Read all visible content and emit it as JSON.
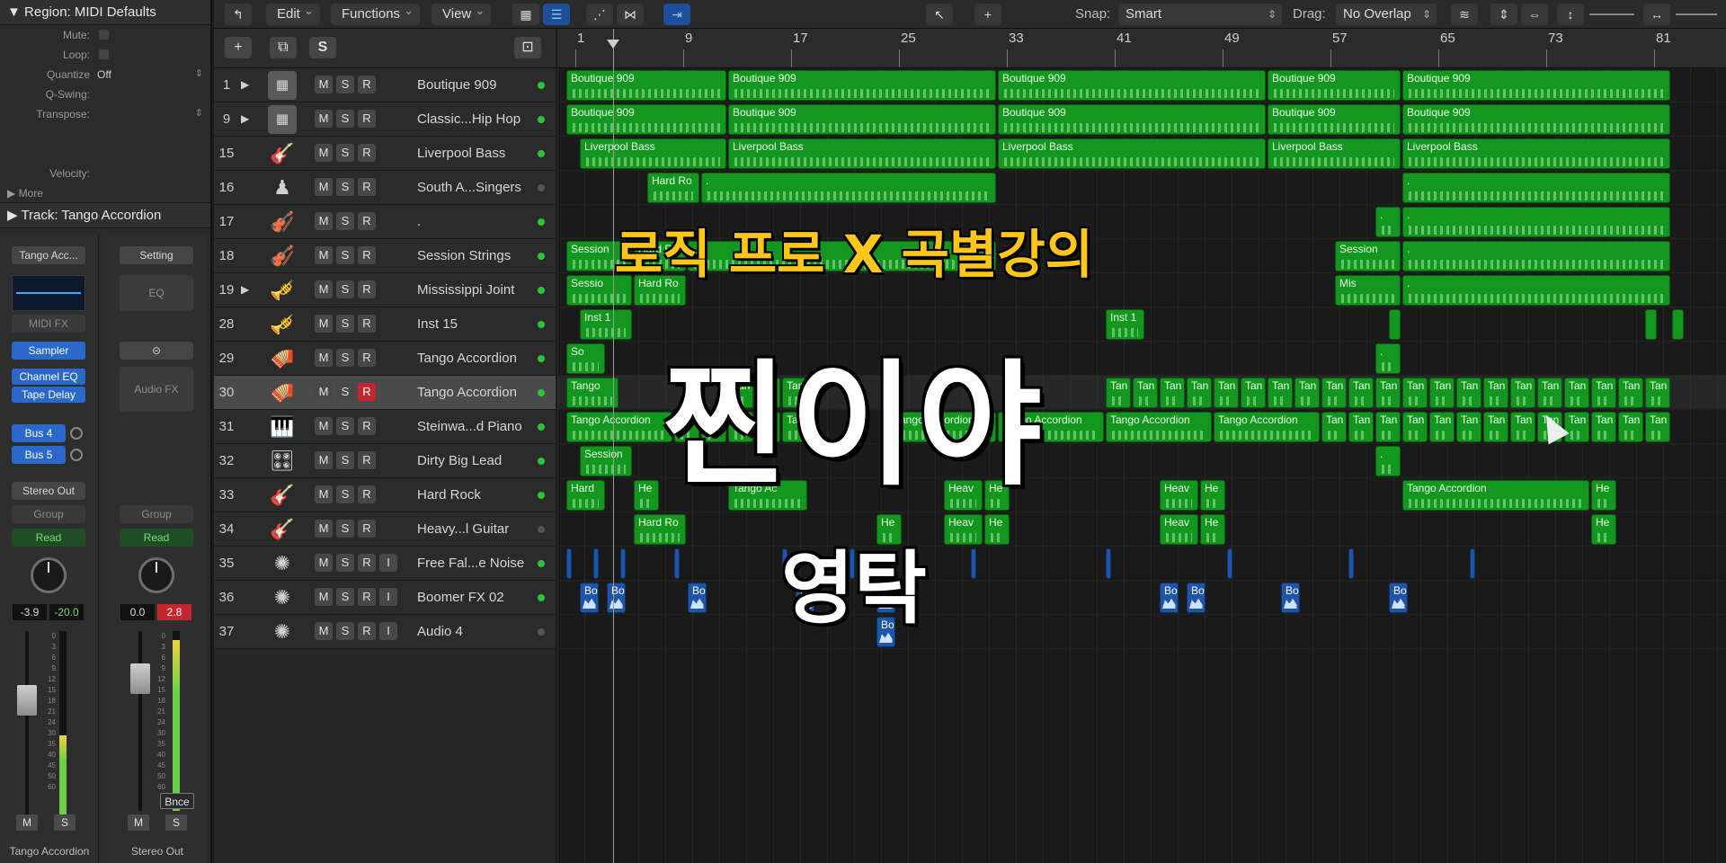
{
  "inspector": {
    "region_title": "Region: MIDI Defaults",
    "fields": [
      {
        "label": "Mute:",
        "value": "",
        "checkbox": true
      },
      {
        "label": "Loop:",
        "value": "",
        "checkbox": true
      },
      {
        "label": "Quantize",
        "value": "Off",
        "updown": true
      },
      {
        "label": "Q-Swing:",
        "value": ""
      },
      {
        "label": "Transpose:",
        "value": "",
        "updown": true
      },
      {
        "label": "",
        "value": ""
      },
      {
        "label": "",
        "value": ""
      },
      {
        "label": "Velocity:",
        "value": ""
      }
    ],
    "more": "More",
    "track_title": "Track:  Tango Accordion",
    "strip1": {
      "setting": "Tango Acc...",
      "midi_fx": "MIDI FX",
      "instrument": "Sampler",
      "fx1": "Channel EQ",
      "fx2": "Tape Delay",
      "send1": "Bus 4",
      "send2": "Bus 5",
      "output": "Stereo Out",
      "group": "Group",
      "automation": "Read",
      "level_left": "-3.9",
      "level_right": "-20.0",
      "mute": "M",
      "solo": "S",
      "name": "Tango Accordion"
    },
    "strip2": {
      "setting": "Setting",
      "eq": "EQ",
      "link": "⊝",
      "audio_fx": "Audio FX",
      "group": "Group",
      "automation": "Read",
      "level_left": "0.0",
      "level_right": "2.8",
      "bounce": "Bnce",
      "mute": "M",
      "solo": "S",
      "name": "Stereo Out"
    },
    "scale": [
      "0",
      "3",
      "6",
      "9",
      "12",
      "15",
      "18",
      "21",
      "24",
      "30",
      "35",
      "40",
      "45",
      "50",
      "60"
    ]
  },
  "toolbar": {
    "back_icon": "↰",
    "menus": [
      "Edit",
      "Functions",
      "View"
    ],
    "snap_label": "Snap:",
    "snap_value": "Smart",
    "drag_label": "Drag:",
    "drag_value": "No Overlap"
  },
  "ruler": [
    "1",
    "9",
    "17",
    "25",
    "33",
    "41",
    "49",
    "57",
    "65",
    "73",
    "81"
  ],
  "tracks": [
    {
      "num": "1",
      "name": "Boutique 909",
      "icon": "drum-machine-icon",
      "glyph": "▦",
      "disc": true,
      "input": false,
      "led": "#2ec43a"
    },
    {
      "num": "9",
      "name": "Classic...Hip Hop",
      "icon": "drum-machine-icon",
      "glyph": "▦",
      "disc": true,
      "input": false,
      "led": "#2ec43a"
    },
    {
      "num": "15",
      "name": "Liverpool Bass",
      "icon": "bass-guitar-icon",
      "glyph": "🎸",
      "disc": false,
      "input": false,
      "led": "#2ec43a"
    },
    {
      "num": "16",
      "name": "South A...Singers",
      "icon": "choir-icon",
      "glyph": "♟",
      "disc": false,
      "input": false,
      "led": "#555555"
    },
    {
      "num": "17",
      "name": ".",
      "icon": "violin-icon",
      "glyph": "🎻",
      "disc": false,
      "input": false,
      "led": "#2ec43a"
    },
    {
      "num": "18",
      "name": "Session Strings",
      "icon": "strings-icon",
      "glyph": "🎻",
      "disc": false,
      "input": false,
      "led": "#2ec43a"
    },
    {
      "num": "19",
      "name": "Mississippi Joint",
      "icon": "horns-icon",
      "glyph": "🎺",
      "disc": true,
      "input": false,
      "led": "#2ec43a"
    },
    {
      "num": "28",
      "name": "Inst 15",
      "icon": "horns-icon",
      "glyph": "🎺",
      "disc": false,
      "input": false,
      "led": "#2ec43a"
    },
    {
      "num": "29",
      "name": "Tango Accordion",
      "icon": "accordion-icon",
      "glyph": "🪗",
      "disc": false,
      "input": false,
      "led": "#2ec43a"
    },
    {
      "num": "30",
      "name": "Tango Accordion",
      "icon": "accordion-icon",
      "glyph": "🪗",
      "disc": false,
      "input": false,
      "led": "#2ec43a",
      "selected": true,
      "armed": true
    },
    {
      "num": "31",
      "name": "Steinwa...d Piano",
      "icon": "grand-piano-icon",
      "glyph": "🎹",
      "disc": false,
      "input": false,
      "led": "#2ec43a"
    },
    {
      "num": "32",
      "name": "Dirty Big Lead",
      "icon": "synth-icon",
      "glyph": "🎛",
      "disc": false,
      "input": false,
      "led": "#2ec43a"
    },
    {
      "num": "33",
      "name": "Hard Rock",
      "icon": "electric-guitar-icon",
      "glyph": "🎸",
      "disc": false,
      "input": false,
      "led": "#2ec43a"
    },
    {
      "num": "34",
      "name": "Heavy...l Guitar",
      "icon": "electric-guitar-icon",
      "glyph": "🎸",
      "disc": false,
      "input": false,
      "led": "#555555"
    },
    {
      "num": "35",
      "name": "Free Fal...e Noise",
      "icon": "fx-burst-icon",
      "glyph": "✺",
      "disc": false,
      "input": true,
      "led": "#2ec43a"
    },
    {
      "num": "36",
      "name": "Boomer FX 02",
      "icon": "fx-burst-icon",
      "glyph": "✺",
      "disc": false,
      "input": true,
      "led": "#2ec43a"
    },
    {
      "num": "37",
      "name": "Audio 4",
      "icon": "fx-burst-icon",
      "glyph": "✺",
      "disc": false,
      "input": true,
      "led": "#555555"
    }
  ],
  "regions": [
    {
      "lane": 0,
      "bar": 1,
      "len": 12,
      "name": "Boutique 909"
    },
    {
      "lane": 0,
      "bar": 13,
      "len": 20,
      "name": "Boutique 909"
    },
    {
      "lane": 0,
      "bar": 33,
      "len": 20,
      "name": "Boutique 909"
    },
    {
      "lane": 0,
      "bar": 53,
      "len": 10,
      "name": "Boutique 909"
    },
    {
      "lane": 0,
      "bar": 63,
      "len": 20,
      "name": "Boutique 909"
    },
    {
      "lane": 1,
      "bar": 1,
      "len": 12,
      "name": "Boutique 909"
    },
    {
      "lane": 1,
      "bar": 13,
      "len": 20,
      "name": "Boutique 909"
    },
    {
      "lane": 1,
      "bar": 33,
      "len": 20,
      "name": "Boutique 909"
    },
    {
      "lane": 1,
      "bar": 53,
      "len": 10,
      "name": "Boutique 909"
    },
    {
      "lane": 1,
      "bar": 63,
      "len": 20,
      "name": "Boutique 909"
    },
    {
      "lane": 2,
      "bar": 2,
      "len": 11,
      "name": "Liverpool Bass"
    },
    {
      "lane": 2,
      "bar": 13,
      "len": 20,
      "name": "Liverpool Bass"
    },
    {
      "lane": 2,
      "bar": 33,
      "len": 20,
      "name": "Liverpool Bass"
    },
    {
      "lane": 2,
      "bar": 53,
      "len": 10,
      "name": "Liverpool Bass"
    },
    {
      "lane": 2,
      "bar": 63,
      "len": 20,
      "name": "Liverpool Bass"
    },
    {
      "lane": 3,
      "bar": 7,
      "len": 4,
      "name": "Hard Ro"
    },
    {
      "lane": 3,
      "bar": 11,
      "len": 22,
      "name": "."
    },
    {
      "lane": 3,
      "bar": 63,
      "len": 20,
      "name": "."
    },
    {
      "lane": 4,
      "bar": 61,
      "len": 2,
      "name": "."
    },
    {
      "lane": 4,
      "bar": 63,
      "len": 20,
      "name": "."
    },
    {
      "lane": 5,
      "bar": 1,
      "len": 5,
      "name": "Session"
    },
    {
      "lane": 5,
      "bar": 6,
      "len": 4,
      "name": "Hard Ro"
    },
    {
      "lane": 5,
      "bar": 10,
      "len": 23,
      "name": ""
    },
    {
      "lane": 5,
      "bar": 58,
      "len": 5,
      "name": "Session"
    },
    {
      "lane": 5,
      "bar": 63,
      "len": 20,
      "name": "."
    },
    {
      "lane": 6,
      "bar": 1,
      "len": 5,
      "name": "Sessio"
    },
    {
      "lane": 6,
      "bar": 6,
      "len": 4,
      "name": "Hard Ro"
    },
    {
      "lane": 6,
      "bar": 58,
      "len": 5,
      "name": "Mis"
    },
    {
      "lane": 6,
      "bar": 63,
      "len": 20,
      "name": "."
    },
    {
      "lane": 7,
      "bar": 2,
      "len": 4,
      "name": "Inst 1"
    },
    {
      "lane": 7,
      "bar": 41,
      "len": 3,
      "name": "Inst 1"
    },
    {
      "lane": 7,
      "bar": 62,
      "len": 1,
      "name": ""
    },
    {
      "lane": 7,
      "bar": 81,
      "len": 1,
      "name": ""
    },
    {
      "lane": 7,
      "bar": 83,
      "len": 1,
      "name": ""
    },
    {
      "lane": 8,
      "bar": 1,
      "len": 3,
      "name": "So"
    },
    {
      "lane": 8,
      "bar": 61,
      "len": 2,
      "name": "."
    },
    {
      "lane": 9,
      "bar": 1,
      "len": 4,
      "name": "Tango"
    },
    {
      "lane": 9,
      "bar": 13,
      "len": 2,
      "name": "Tan"
    },
    {
      "lane": 9,
      "bar": 15,
      "len": 2,
      "name": "Tan"
    },
    {
      "lane": 9,
      "bar": 17,
      "len": 2,
      "name": "Tan"
    },
    {
      "lane": 9,
      "bar": 41,
      "len": 2,
      "name": "Tan"
    },
    {
      "lane": 9,
      "bar": 43,
      "len": 2,
      "name": "Tan"
    },
    {
      "lane": 9,
      "bar": 45,
      "len": 2,
      "name": "Tan"
    },
    {
      "lane": 9,
      "bar": 47,
      "len": 2,
      "name": "Tan"
    },
    {
      "lane": 9,
      "bar": 49,
      "len": 2,
      "name": "Tan"
    },
    {
      "lane": 9,
      "bar": 51,
      "len": 2,
      "name": "Tan"
    },
    {
      "lane": 9,
      "bar": 53,
      "len": 2,
      "name": "Tan"
    },
    {
      "lane": 9,
      "bar": 55,
      "len": 2,
      "name": "Tan"
    },
    {
      "lane": 9,
      "bar": 57,
      "len": 2,
      "name": "Tan"
    },
    {
      "lane": 9,
      "bar": 59,
      "len": 2,
      "name": "Tan"
    },
    {
      "lane": 9,
      "bar": 61,
      "len": 2,
      "name": "Tan"
    },
    {
      "lane": 9,
      "bar": 63,
      "len": 2,
      "name": "Tan"
    },
    {
      "lane": 9,
      "bar": 65,
      "len": 2,
      "name": "Tan"
    },
    {
      "lane": 9,
      "bar": 67,
      "len": 2,
      "name": "Tan"
    },
    {
      "lane": 9,
      "bar": 69,
      "len": 2,
      "name": "Tan"
    },
    {
      "lane": 9,
      "bar": 71,
      "len": 2,
      "name": "Tan"
    },
    {
      "lane": 9,
      "bar": 73,
      "len": 2,
      "name": "Tan"
    },
    {
      "lane": 9,
      "bar": 75,
      "len": 2,
      "name": "Tan"
    },
    {
      "lane": 9,
      "bar": 77,
      "len": 2,
      "name": "Tan"
    },
    {
      "lane": 9,
      "bar": 79,
      "len": 2,
      "name": "Tan"
    },
    {
      "lane": 9,
      "bar": 81,
      "len": 2,
      "name": "Tan"
    },
    {
      "lane": 10,
      "bar": 1,
      "len": 8,
      "name": "Tango Accordion"
    },
    {
      "lane": 10,
      "bar": 9,
      "len": 2,
      "name": "Tan"
    },
    {
      "lane": 10,
      "bar": 11,
      "len": 2,
      "name": "Tan"
    },
    {
      "lane": 10,
      "bar": 13,
      "len": 2,
      "name": "Tan"
    },
    {
      "lane": 10,
      "bar": 15,
      "len": 2,
      "name": "Tan"
    },
    {
      "lane": 10,
      "bar": 17,
      "len": 2,
      "name": "Tan"
    },
    {
      "lane": 10,
      "bar": 25,
      "len": 8,
      "name": "Tango Accordion"
    },
    {
      "lane": 10,
      "bar": 33,
      "len": 8,
      "name": "Tango Accordion"
    },
    {
      "lane": 10,
      "bar": 41,
      "len": 8,
      "name": "Tango Accordion"
    },
    {
      "lane": 10,
      "bar": 49,
      "len": 8,
      "name": "Tango Accordion"
    },
    {
      "lane": 10,
      "bar": 57,
      "len": 2,
      "name": "Tan"
    },
    {
      "lane": 10,
      "bar": 59,
      "len": 2,
      "name": "Tan"
    },
    {
      "lane": 10,
      "bar": 61,
      "len": 2,
      "name": "Tan"
    },
    {
      "lane": 10,
      "bar": 63,
      "len": 2,
      "name": "Tan"
    },
    {
      "lane": 10,
      "bar": 65,
      "len": 2,
      "name": "Tan"
    },
    {
      "lane": 10,
      "bar": 67,
      "len": 2,
      "name": "Tan"
    },
    {
      "lane": 10,
      "bar": 69,
      "len": 2,
      "name": "Tan"
    },
    {
      "lane": 10,
      "bar": 71,
      "len": 2,
      "name": "Tan"
    },
    {
      "lane": 10,
      "bar": 73,
      "len": 2,
      "name": "Tan"
    },
    {
      "lane": 10,
      "bar": 75,
      "len": 2,
      "name": "Tan"
    },
    {
      "lane": 10,
      "bar": 77,
      "len": 2,
      "name": "Tan"
    },
    {
      "lane": 10,
      "bar": 79,
      "len": 2,
      "name": "Tan"
    },
    {
      "lane": 10,
      "bar": 81,
      "len": 2,
      "name": "Tan"
    },
    {
      "lane": 11,
      "bar": 2,
      "len": 4,
      "name": "Session"
    },
    {
      "lane": 11,
      "bar": 61,
      "len": 2,
      "name": "."
    },
    {
      "lane": 12,
      "bar": 1,
      "len": 3,
      "name": "Hard"
    },
    {
      "lane": 12,
      "bar": 6,
      "len": 2,
      "name": "He"
    },
    {
      "lane": 12,
      "bar": 13,
      "len": 6,
      "name": "Tango Ac"
    },
    {
      "lane": 12,
      "bar": 29,
      "len": 3,
      "name": "Heav"
    },
    {
      "lane": 12,
      "bar": 32,
      "len": 2,
      "name": "He"
    },
    {
      "lane": 12,
      "bar": 45,
      "len": 3,
      "name": "Heav"
    },
    {
      "lane": 12,
      "bar": 48,
      "len": 2,
      "name": "He"
    },
    {
      "lane": 12,
      "bar": 63,
      "len": 14,
      "name": "Tango Accordion"
    },
    {
      "lane": 12,
      "bar": 77,
      "len": 2,
      "name": "He"
    },
    {
      "lane": 13,
      "bar": 6,
      "len": 4,
      "name": "Hard Ro"
    },
    {
      "lane": 13,
      "bar": 24,
      "len": 2,
      "name": "He"
    },
    {
      "lane": 13,
      "bar": 29,
      "len": 3,
      "name": "Heav"
    },
    {
      "lane": 13,
      "bar": 32,
      "len": 2,
      "name": "He"
    },
    {
      "lane": 13,
      "bar": 45,
      "len": 3,
      "name": "Heav"
    },
    {
      "lane": 13,
      "bar": 48,
      "len": 2,
      "name": "He"
    },
    {
      "lane": 13,
      "bar": 77,
      "len": 2,
      "name": "He"
    },
    {
      "lane": 14,
      "bar": 1,
      "len": 0.5,
      "name": "",
      "audio": true
    },
    {
      "lane": 14,
      "bar": 3,
      "len": 0.5,
      "name": "",
      "audio": true
    },
    {
      "lane": 14,
      "bar": 5,
      "len": 0.5,
      "name": "",
      "audio": true
    },
    {
      "lane": 14,
      "bar": 9,
      "len": 0.5,
      "name": "",
      "audio": true
    },
    {
      "lane": 14,
      "bar": 17,
      "len": 0.5,
      "name": "",
      "audio": true
    },
    {
      "lane": 14,
      "bar": 22,
      "len": 0.5,
      "name": "",
      "audio": true
    },
    {
      "lane": 14,
      "bar": 31,
      "len": 0.5,
      "name": "",
      "audio": true
    },
    {
      "lane": 14,
      "bar": 41,
      "len": 0.5,
      "name": "",
      "audio": true
    },
    {
      "lane": 14,
      "bar": 50,
      "len": 0.5,
      "name": "",
      "audio": true
    },
    {
      "lane": 14,
      "bar": 59,
      "len": 0.5,
      "name": "",
      "audio": true
    },
    {
      "lane": 14,
      "bar": 68,
      "len": 0.5,
      "name": "",
      "audio": true
    },
    {
      "lane": 15,
      "bar": 2,
      "len": 1.5,
      "name": "Bo",
      "audio": true
    },
    {
      "lane": 15,
      "bar": 4,
      "len": 1.5,
      "name": "Bo",
      "audio": true
    },
    {
      "lane": 15,
      "bar": 10,
      "len": 1.5,
      "name": "Bo",
      "audio": true
    },
    {
      "lane": 15,
      "bar": 18,
      "len": 1.5,
      "name": "Bo",
      "audio": true
    },
    {
      "lane": 15,
      "bar": 24,
      "len": 1.5,
      "name": "Bo",
      "audio": true
    },
    {
      "lane": 15,
      "bar": 45,
      "len": 1.5,
      "name": "Bo",
      "audio": true
    },
    {
      "lane": 15,
      "bar": 47,
      "len": 1.5,
      "name": "Bo",
      "audio": true
    },
    {
      "lane": 15,
      "bar": 54,
      "len": 1.5,
      "name": "Bo",
      "audio": true
    },
    {
      "lane": 15,
      "bar": 62,
      "len": 1.5,
      "name": "Bo",
      "audio": true
    },
    {
      "lane": 16,
      "bar": 24,
      "len": 1.5,
      "name": "Bo",
      "audio": true
    }
  ],
  "overlay": {
    "subtitle": "로직 프로 X 곡별강의",
    "title": "찐이야",
    "artist": "영탁"
  },
  "colors": {
    "midi_region": "#13971e",
    "audio_region": "#1e55a8",
    "subtitle": "#ffc61a",
    "record": "#c4262e"
  }
}
